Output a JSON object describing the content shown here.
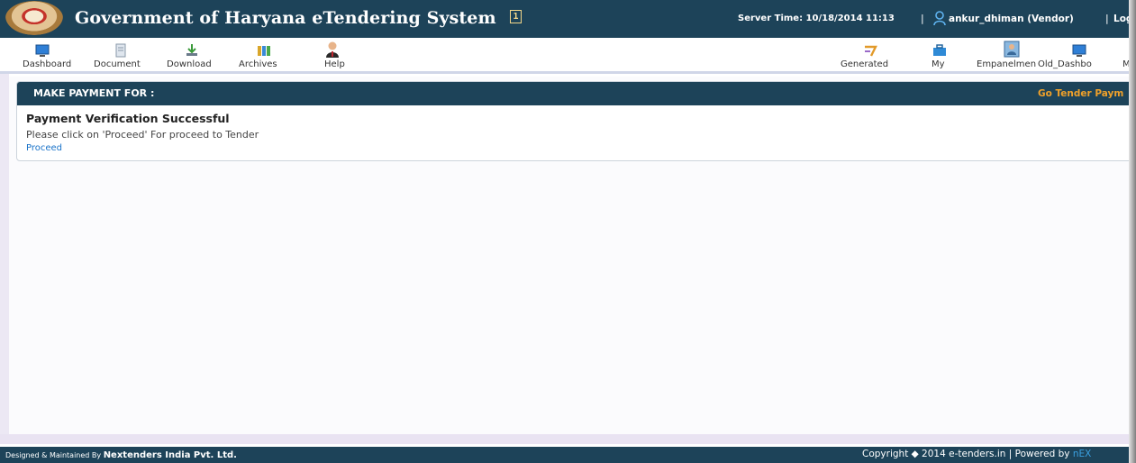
{
  "header": {
    "title": "Government of Haryana eTendering System",
    "info_badge": "1",
    "server_time": "Server Time: 10/18/2014 11:13",
    "separator": "|",
    "user": "ankur_dhiman (Vendor)",
    "logout": "Log"
  },
  "toolbar": {
    "left": [
      {
        "label": "Dashboard",
        "icon": "dashboard-icon"
      },
      {
        "label": "Document",
        "icon": "document-icon"
      },
      {
        "label": "Download",
        "icon": "download-icon"
      },
      {
        "label": "Archives",
        "icon": "archives-icon"
      },
      {
        "label": "Help",
        "icon": "help-icon"
      }
    ],
    "right": [
      {
        "label": "Generated",
        "icon": "generated-icon"
      },
      {
        "label": "My",
        "icon": "briefcase-icon"
      },
      {
        "label": "Empanelmen",
        "icon": "empanelment-icon"
      },
      {
        "label": "Old_Dashbo",
        "icon": "old-dashboard-icon"
      },
      {
        "label": "M",
        "icon": ""
      }
    ]
  },
  "panel": {
    "title": "MAKE PAYMENT FOR :",
    "link": "Go Tender Paym",
    "heading": "Payment Verification Successful",
    "message": "Please click on 'Proceed' For proceed to Tender",
    "proceed": "Proceed"
  },
  "footer": {
    "left_prefix": "Designed & Maintained By",
    "company": "Nextenders India Pvt. Ltd.",
    "copyright": "Copyright ◆ 2014 e-tenders.in | Powered by",
    "brand": "nEX"
  },
  "colors": {
    "header_bg": "#1d4359",
    "link_orange": "#f0a12a",
    "link_blue": "#1a73c9"
  }
}
